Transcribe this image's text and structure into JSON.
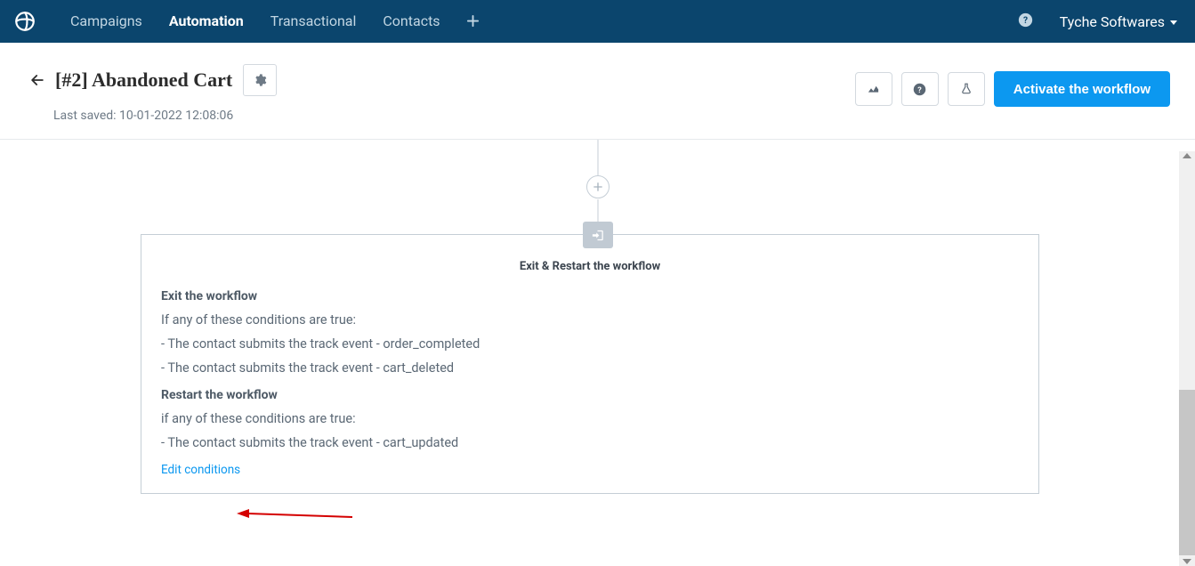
{
  "nav": {
    "items": [
      "Campaigns",
      "Automation",
      "Transactional",
      "Contacts"
    ],
    "active_index": 1,
    "account_label": "Tyche Softwares"
  },
  "header": {
    "title": "[#2] Abandoned Cart",
    "last_saved_label": "Last saved: 10-01-2022 12:08:06",
    "activate_label": "Activate the workflow"
  },
  "card": {
    "title": "Exit & Restart the workflow",
    "exit_head": "Exit the workflow",
    "exit_sub": "If any of these conditions are true:",
    "exit_conditions": [
      "- The contact submits the track event - order_completed",
      "- The contact submits the track event - cart_deleted"
    ],
    "restart_head": "Restart the workflow",
    "restart_sub": "if any of these conditions are true:",
    "restart_conditions": [
      "- The contact submits the track event - cart_updated"
    ],
    "edit_link": "Edit conditions"
  },
  "icons": {
    "plus": "＋",
    "help": "?",
    "gear": "⚙",
    "stats": "stats",
    "flask": "flask",
    "exit": "↪"
  }
}
